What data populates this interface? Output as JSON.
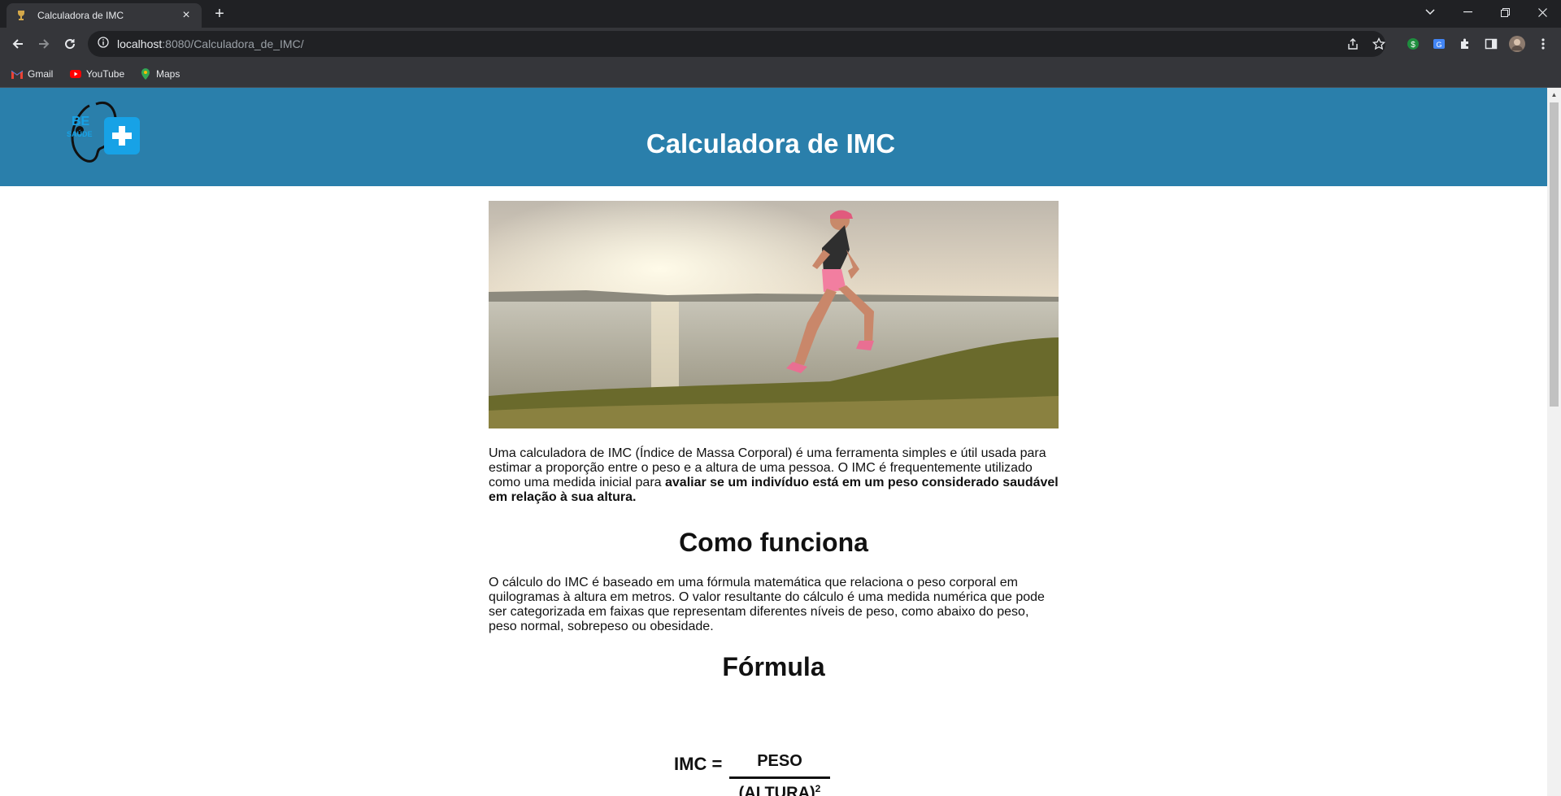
{
  "browser": {
    "tab": {
      "title": "Calculadora de IMC"
    },
    "url": {
      "host": "localhost",
      "path": ":8080/Calculadora_de_IMC/"
    },
    "bookmarks": [
      {
        "label": "Gmail",
        "icon": "gmail-icon"
      },
      {
        "label": "YouTube",
        "icon": "youtube-icon"
      },
      {
        "label": "Maps",
        "icon": "maps-icon"
      }
    ]
  },
  "header": {
    "title": "Calculadora de IMC",
    "logo": {
      "text_line1": "BE",
      "text_line2": "SAÚDE",
      "icon": "stethoscope-plus-logo"
    }
  },
  "main": {
    "hero_image": {
      "icon": "runner-photo"
    },
    "intro": {
      "text": "Uma calculadora de IMC (Índice de Massa Corporal) é uma ferramenta simples e útil usada para estimar a proporção entre o peso e a altura de uma pessoa. O IMC é frequentemente utilizado como uma medida inicial para ",
      "bold": "avaliar se um indivíduo está em um peso considerado saudável em relação à sua altura."
    },
    "how_it_works": {
      "heading": "Como funciona",
      "text": "O cálculo do IMC é baseado em uma fórmula matemática que relaciona o peso corporal em quilogramas à altura em metros. O valor resultante do cálculo é uma medida numérica que pode ser categorizada em faixas que representam diferentes níveis de peso, como abaixo do peso, peso normal, sobrepeso ou obesidade."
    },
    "formula": {
      "heading": "Fórmula",
      "lhs": "IMC =",
      "numerator": "PESO",
      "denominator": "(ALTURA)",
      "exponent": "2"
    }
  },
  "colors": {
    "header_bg": "#2a7fab",
    "logo_blue": "#17a2e6",
    "chrome_dark": "#202124",
    "chrome_mid": "#35363a"
  }
}
